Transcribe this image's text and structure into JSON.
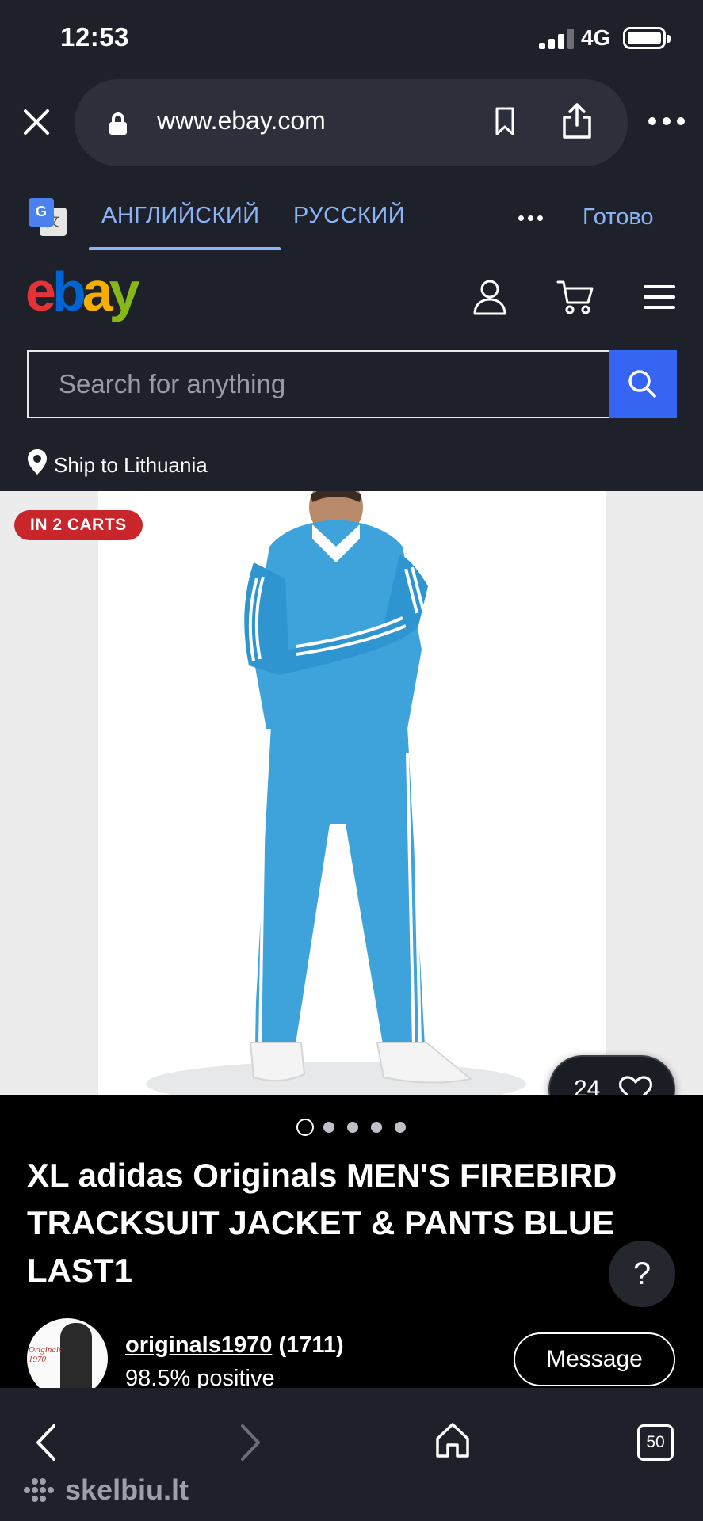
{
  "status_bar": {
    "time": "12:53",
    "network": "4G"
  },
  "browser": {
    "url": "www.ebay.com"
  },
  "translate_bar": {
    "tab_source": "АНГЛИЙСКИЙ",
    "tab_target": "РУССКИЙ",
    "done_label": "Готово"
  },
  "ebay": {
    "logo": {
      "e": "e",
      "b": "b",
      "a": "a",
      "y": "y"
    },
    "search_placeholder": "Search for anything",
    "ship_to": "Ship to Lithuania"
  },
  "listing": {
    "cart_badge": "IN 2 CARTS",
    "favorites_count": "24",
    "image_index": 1,
    "image_total": 5,
    "title": "XL adidas Originals MEN'S FIREBIRD TRACKSUIT JACKET & PANTS BLUE LAST1",
    "help_label": "?",
    "seller": {
      "avatar_text": "Originals 1970",
      "name": "originals1970",
      "feedback_count": "(1711)",
      "positive": "98.5% positive"
    },
    "message_label": "Message"
  },
  "toolbar": {
    "tabs_count": "50"
  },
  "watermark": "skelbiu.lt",
  "colors": {
    "background": "#1f212a",
    "search_button": "#3665f3",
    "badge": "#c8262b",
    "translate_accent": "#8ab4f8",
    "product_blue": "#3fa3db"
  }
}
